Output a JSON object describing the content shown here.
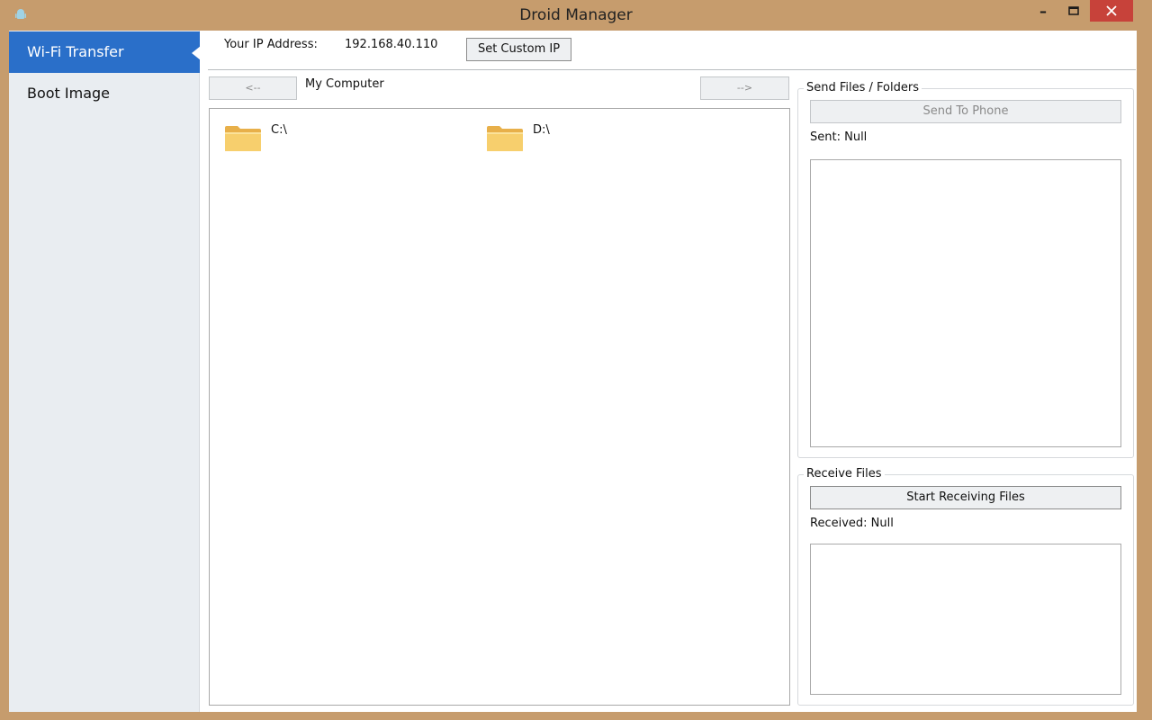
{
  "window": {
    "title": "Droid Manager",
    "minimize_glyph": "–",
    "maximize_glyph": "▫",
    "close_glyph": "✕",
    "icon": "android-icon"
  },
  "sidebar": {
    "items": [
      {
        "label": "Wi-Fi Transfer",
        "active": true
      },
      {
        "label": "Boot Image",
        "active": false
      }
    ]
  },
  "topbar": {
    "ip_label": "Your IP Address:",
    "ip_value": "192.168.40.110",
    "custom_ip_button": "Set Custom IP"
  },
  "browser": {
    "back_label": "<--",
    "forward_label": "-->",
    "path": "My Computer",
    "drives": [
      {
        "label": "C:\\",
        "icon": "folder-icon"
      },
      {
        "label": "D:\\",
        "icon": "folder-icon"
      }
    ]
  },
  "send_group": {
    "title": "Send Files / Folders",
    "button": "Send To Phone",
    "status": "Sent: Null"
  },
  "receive_group": {
    "title": "Receive Files",
    "button": "Start Receiving Files",
    "status": "Received: Null"
  },
  "colors": {
    "chrome": "#c69c6d",
    "accent": "#2a6fc9",
    "close": "#c7423a",
    "sidebar_bg": "#e9edf1"
  }
}
